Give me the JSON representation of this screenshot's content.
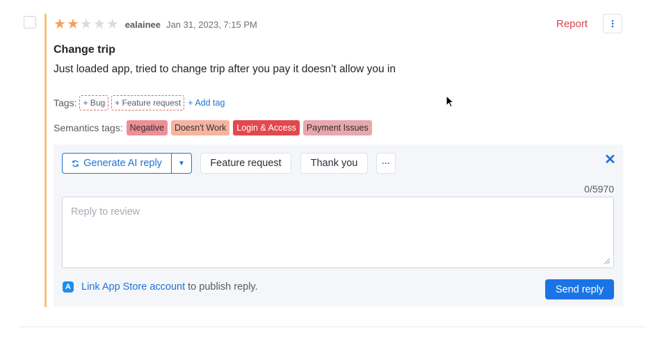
{
  "review": {
    "rating": 2,
    "max_rating": 5,
    "author": "ealainee",
    "date": "Jan 31, 2023, 7:15 PM",
    "report_label": "Report",
    "more_icon": "vertical-dots-icon",
    "title": "Change trip",
    "body": "Just loaded app, tried to change trip after you pay it doesn’t allow you in"
  },
  "tags": {
    "label": "Tags:",
    "items": [
      "+ Bug",
      "+ Feature request"
    ],
    "add_label": "+ Add tag"
  },
  "semantics": {
    "label": "Semantics tags:",
    "items": [
      {
        "label": "Negative",
        "color": "#ef8f95"
      },
      {
        "label": "Doesn't Work",
        "color": "#f6b49f"
      },
      {
        "label": "Login & Access",
        "color": "#e2484d"
      },
      {
        "label": "Payment Issues",
        "color": "#e8a7aa"
      }
    ]
  },
  "reply": {
    "generate_label": "Generate AI reply",
    "generate_icon": "refresh-icon",
    "quick_replies": [
      "Feature request",
      "Thank you"
    ],
    "more_label": "···",
    "close_icon": "close-icon",
    "counter": "0/5970",
    "placeholder": "Reply to review",
    "link_text": "Link App Store account",
    "link_suffix": "to publish reply.",
    "send_label": "Send reply"
  },
  "colors": {
    "accent": "#1b74d6",
    "report": "#d9434b",
    "star": "#f5a05c",
    "left_bar": "#f4c07a"
  }
}
